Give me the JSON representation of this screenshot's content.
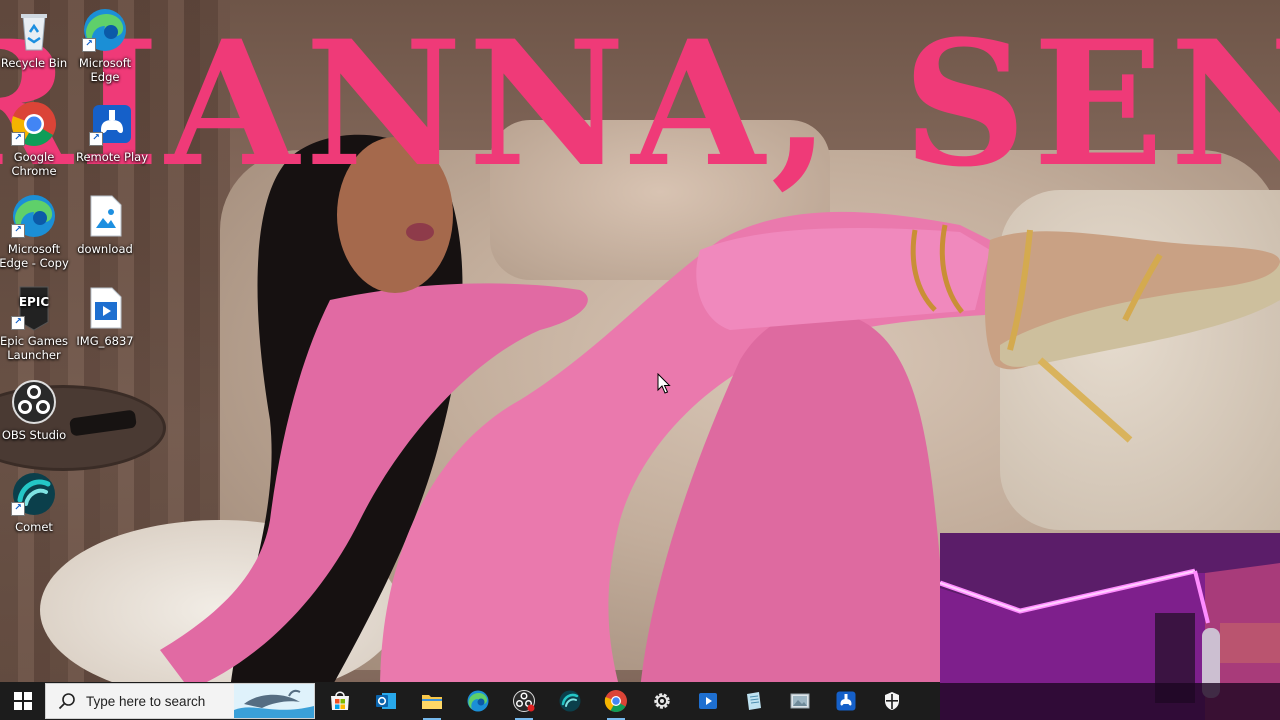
{
  "wallpaper": {
    "headline": "RIANNA, SENI"
  },
  "desktop": {
    "icons": [
      {
        "name": "recycle-bin",
        "label": "Recycle Bin",
        "icon": "recycle-bin-icon"
      },
      {
        "name": "microsoft-edge",
        "label": "Microsoft Edge",
        "icon": "edge-icon"
      },
      {
        "name": "google-chrome",
        "label": "Google Chrome",
        "icon": "chrome-icon"
      },
      {
        "name": "remote-play",
        "label": "Remote Play",
        "icon": "gamepad-icon"
      },
      {
        "name": "microsoft-edge-copy",
        "label": "Microsoft Edge - Copy",
        "icon": "edge-icon"
      },
      {
        "name": "download",
        "label": "download",
        "icon": "image-file-icon"
      },
      {
        "name": "epic-games-launcher",
        "label": "Epic Games Launcher",
        "icon": "epic-games-icon"
      },
      {
        "name": "img-6837",
        "label": "IMG_6837",
        "icon": "video-file-icon"
      },
      {
        "name": "obs-studio",
        "label": "OBS Studio",
        "icon": "obs-icon"
      },
      {
        "name": "comet",
        "label": "Comet",
        "icon": "comet-icon"
      }
    ],
    "icon_labels": {
      "recycle_bin": "Recycle Bin",
      "microsoft_edge": "Microsoft Edge",
      "google_chrome": "Google Chrome",
      "remote_play": "Remote Play",
      "microsoft_edge_copy": "Microsoft Edge - Copy",
      "download": "download",
      "epic_games": "Epic Games Launcher",
      "img_6837": "IMG_6837",
      "obs_studio": "OBS Studio",
      "comet": "Comet"
    },
    "epic_logo_text": "EPIC"
  },
  "taskbar": {
    "search_placeholder": "Type here to search",
    "apps": [
      {
        "name": "microsoft-store",
        "icon": "store-icon"
      },
      {
        "name": "outlook",
        "icon": "outlook-icon"
      },
      {
        "name": "file-explorer",
        "icon": "folder-icon"
      },
      {
        "name": "microsoft-edge",
        "icon": "edge-icon"
      },
      {
        "name": "obs-studio",
        "icon": "obs-icon"
      },
      {
        "name": "comet",
        "icon": "comet-icon"
      },
      {
        "name": "google-chrome",
        "icon": "chrome-icon"
      },
      {
        "name": "settings",
        "icon": "gear-icon"
      },
      {
        "name": "media-player",
        "icon": "play-icon"
      },
      {
        "name": "notepad",
        "icon": "notepad-icon"
      },
      {
        "name": "photos-viewer",
        "icon": "image-viewer-icon"
      },
      {
        "name": "remote-play",
        "icon": "gamepad-icon"
      },
      {
        "name": "windows-security",
        "icon": "shield-icon"
      }
    ]
  },
  "colors": {
    "headline": "#ef3a78",
    "taskbar_bg": "#1c1c1c",
    "accent_blue": "#0078d4",
    "neon_strip": "#ff8cff"
  }
}
